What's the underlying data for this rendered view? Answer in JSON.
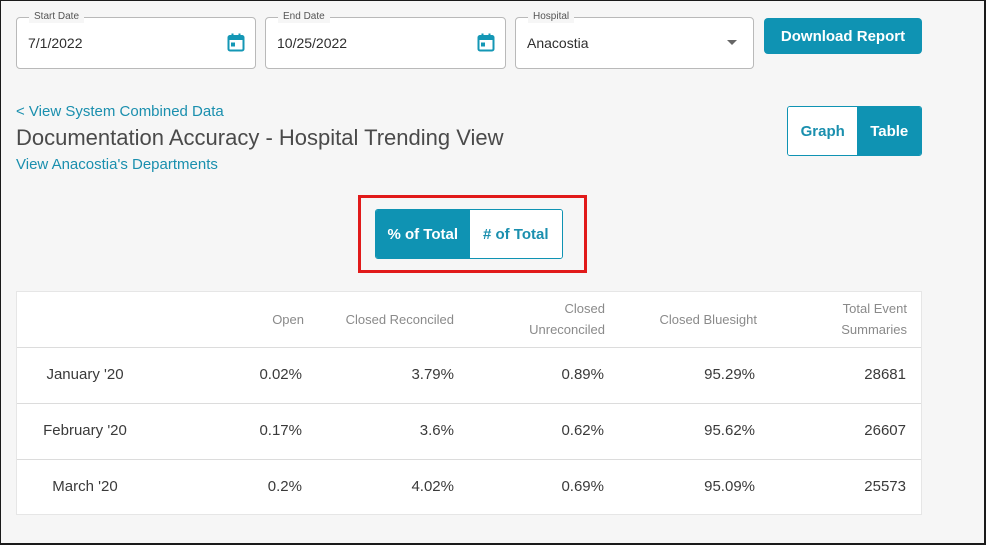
{
  "filters": {
    "start_date": {
      "label": "Start Date",
      "value": "7/1/2022",
      "icon": "calendar-icon"
    },
    "end_date": {
      "label": "End Date",
      "value": "10/25/2022",
      "icon": "calendar-icon"
    },
    "hospital": {
      "label": "Hospital",
      "value": "Anacostia",
      "icon": "chevron-down-icon"
    }
  },
  "download_button": "Download Report",
  "links": {
    "back": "< View System Combined Data",
    "departments": "View Anacostia's Departments"
  },
  "title": "Documentation Accuracy - Hospital Trending View",
  "view_toggle": {
    "graph": "Graph",
    "table": "Table",
    "selected": "Table"
  },
  "metric_toggle": {
    "percent": "% of Total",
    "count": "# of Total",
    "selected": "% of Total"
  },
  "colors": {
    "accent": "#0f93b3",
    "highlight": "#e11a1a"
  },
  "table": {
    "headers": {
      "open": "Open",
      "closed_reconciled": "Closed Reconciled",
      "closed_unreconciled_1": "Closed",
      "closed_unreconciled_2": "Unreconciled",
      "closed_bluesight": "Closed Bluesight",
      "total_1": "Total Event",
      "total_2": "Summaries"
    },
    "rows": [
      {
        "month": "January '20",
        "open": "0.02%",
        "closed_reconciled": "3.79%",
        "closed_unreconciled": "0.89%",
        "closed_bluesight": "95.29%",
        "total": "28681"
      },
      {
        "month": "February '20",
        "open": "0.17%",
        "closed_reconciled": "3.6%",
        "closed_unreconciled": "0.62%",
        "closed_bluesight": "95.62%",
        "total": "26607"
      },
      {
        "month": "March '20",
        "open": "0.2%",
        "closed_reconciled": "4.02%",
        "closed_unreconciled": "0.69%",
        "closed_bluesight": "95.09%",
        "total": "25573"
      }
    ]
  }
}
